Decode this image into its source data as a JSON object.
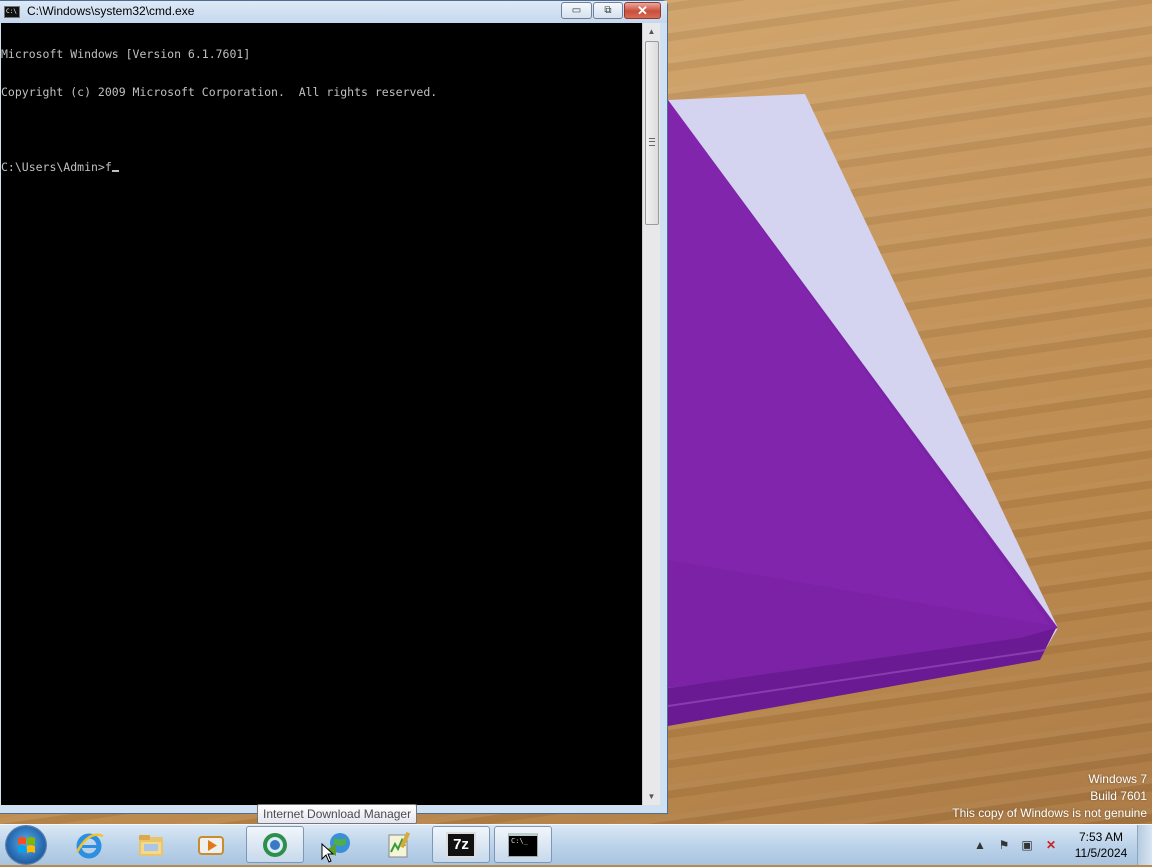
{
  "window": {
    "title": "C:\\Windows\\system32\\cmd.exe",
    "minimize_glyph": "▭",
    "maximize_glyph": "⧉",
    "close_glyph": "✕"
  },
  "console": {
    "lines": [
      "Microsoft Windows [Version 6.1.7601]",
      "Copyright (c) 2009 Microsoft Corporation.  All rights reserved.",
      "",
      "C:\\Users\\Admin>f"
    ]
  },
  "tooltip": "Internet Download Manager",
  "watermark": {
    "line1": "Windows 7",
    "line2": "Build 7601",
    "line3": "This copy of Windows is not genuine"
  },
  "taskbar": {
    "items": [
      {
        "name": "internet-explorer",
        "icon": "ie-icon",
        "active": false
      },
      {
        "name": "windows-explorer",
        "icon": "folder-icon",
        "active": false
      },
      {
        "name": "media-player",
        "icon": "media-player-icon",
        "active": false
      },
      {
        "name": "internet-download-manager",
        "icon": "idm-icon",
        "active": true
      },
      {
        "name": "network-app",
        "icon": "globe-icon",
        "active": false
      },
      {
        "name": "notepad-app",
        "icon": "notepad-icon",
        "active": false
      },
      {
        "name": "7zip",
        "icon": "7zip-icon",
        "active": true,
        "label": "7z"
      },
      {
        "name": "command-prompt",
        "icon": "cmd-icon",
        "active": true,
        "label": "C:\\_"
      }
    ],
    "clock": {
      "time": "7:53 AM",
      "date": "11/5/2024"
    },
    "tray": {
      "chevron": "▲",
      "flag": "⚑",
      "network": "▣",
      "volume": "✕"
    }
  },
  "colors": {
    "console_bg": "#000000",
    "console_fg": "#c0c0c0",
    "box_purple": "#7f22a8",
    "box_white": "#d0cfee"
  }
}
